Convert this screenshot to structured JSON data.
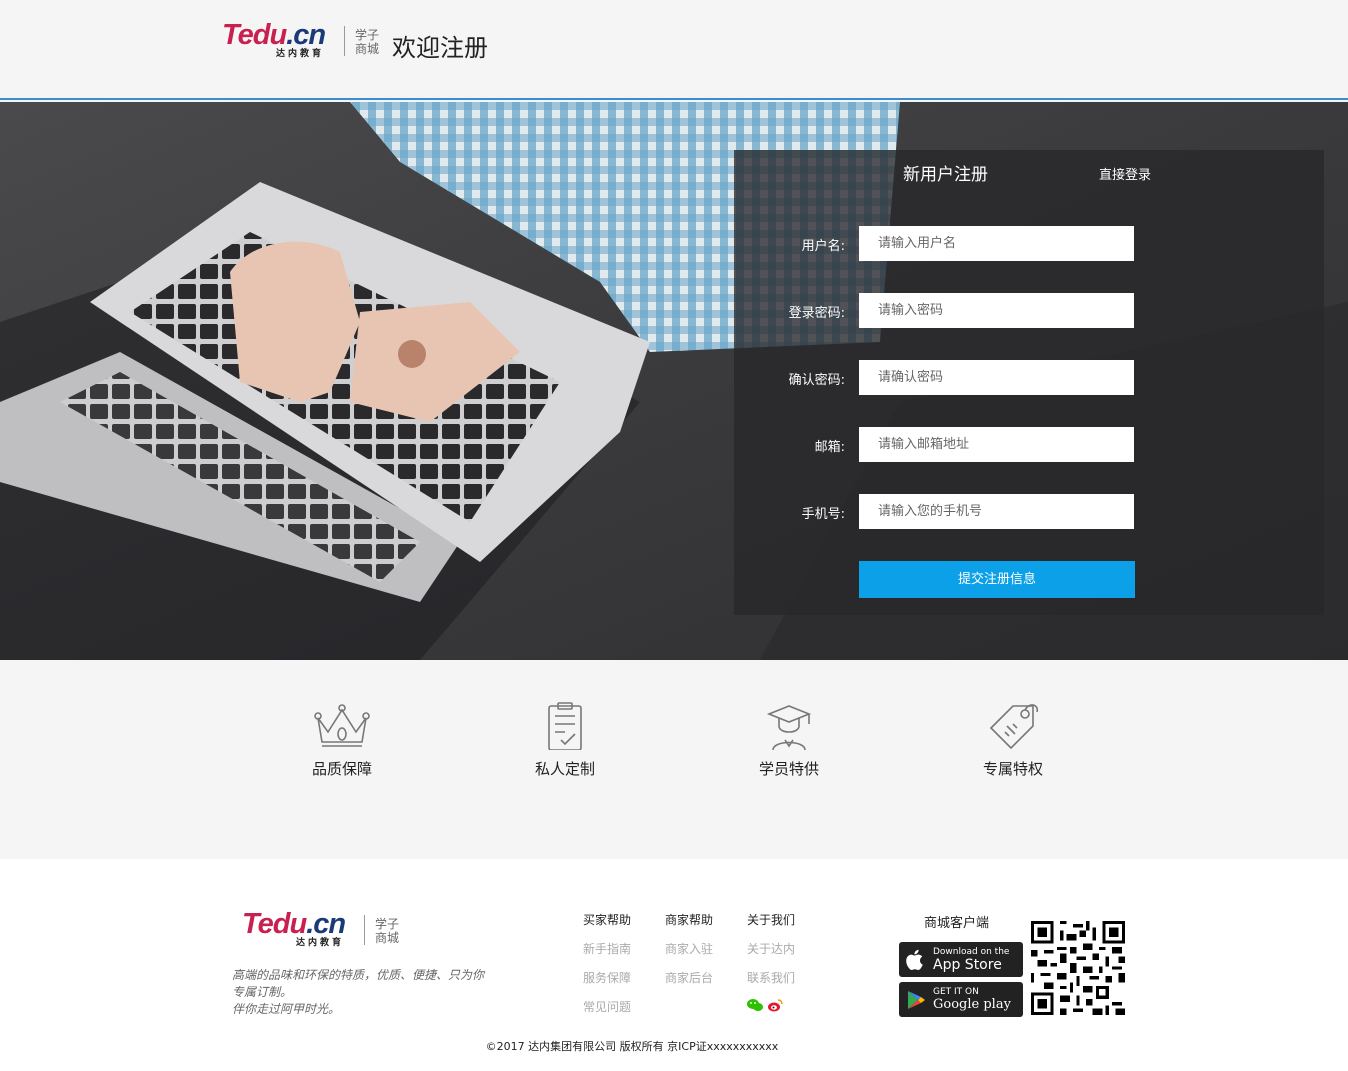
{
  "header": {
    "logo_word_left": "Tedu",
    "logo_word_right": ".cn",
    "logo_sub": "达内教育",
    "logo_tag_line1": "学子",
    "logo_tag_line2": "商城",
    "title": "欢迎注册"
  },
  "form": {
    "tab_register": "新用户注册",
    "tab_login": "直接登录",
    "fields": [
      {
        "label": "用户名:",
        "placeholder": "请输入用户名"
      },
      {
        "label": "登录密码:",
        "placeholder": "请输入密码"
      },
      {
        "label": "确认密码:",
        "placeholder": "请确认密码"
      },
      {
        "label": "邮箱:",
        "placeholder": "请输入邮箱地址"
      },
      {
        "label": "手机号:",
        "placeholder": "请输入您的手机号"
      }
    ],
    "submit_label": "提交注册信息",
    "accent": "#0ba0e8"
  },
  "features": [
    {
      "label": "品质保障",
      "icon": "crown-icon"
    },
    {
      "label": "私人定制",
      "icon": "clipboard-icon"
    },
    {
      "label": "学员特供",
      "icon": "graduate-icon"
    },
    {
      "label": "专属特权",
      "icon": "tag-icon"
    }
  ],
  "footer": {
    "slogan_line1": "高端的品味和环保的特质，优质、便捷、只为你",
    "slogan_line2": "专属订制。",
    "slogan_line3": "伴你走过阿甲时光。",
    "columns": [
      {
        "heading": "买家帮助",
        "links": [
          "新手指南",
          "服务保障",
          "常见问题"
        ]
      },
      {
        "heading": "商家帮助",
        "links": [
          "商家入驻",
          "商家后台"
        ]
      },
      {
        "heading": "关于我们",
        "links": [
          "关于达内",
          "联系我们"
        ]
      }
    ],
    "client_title": "商城客户端",
    "appstore_small": "Download on the",
    "appstore_big": "App Store",
    "googleplay_small": "GET IT ON",
    "googleplay_big": "Google play",
    "copyright": "©2017 达内集团有限公司 版权所有 京ICP证xxxxxxxxxxx"
  }
}
